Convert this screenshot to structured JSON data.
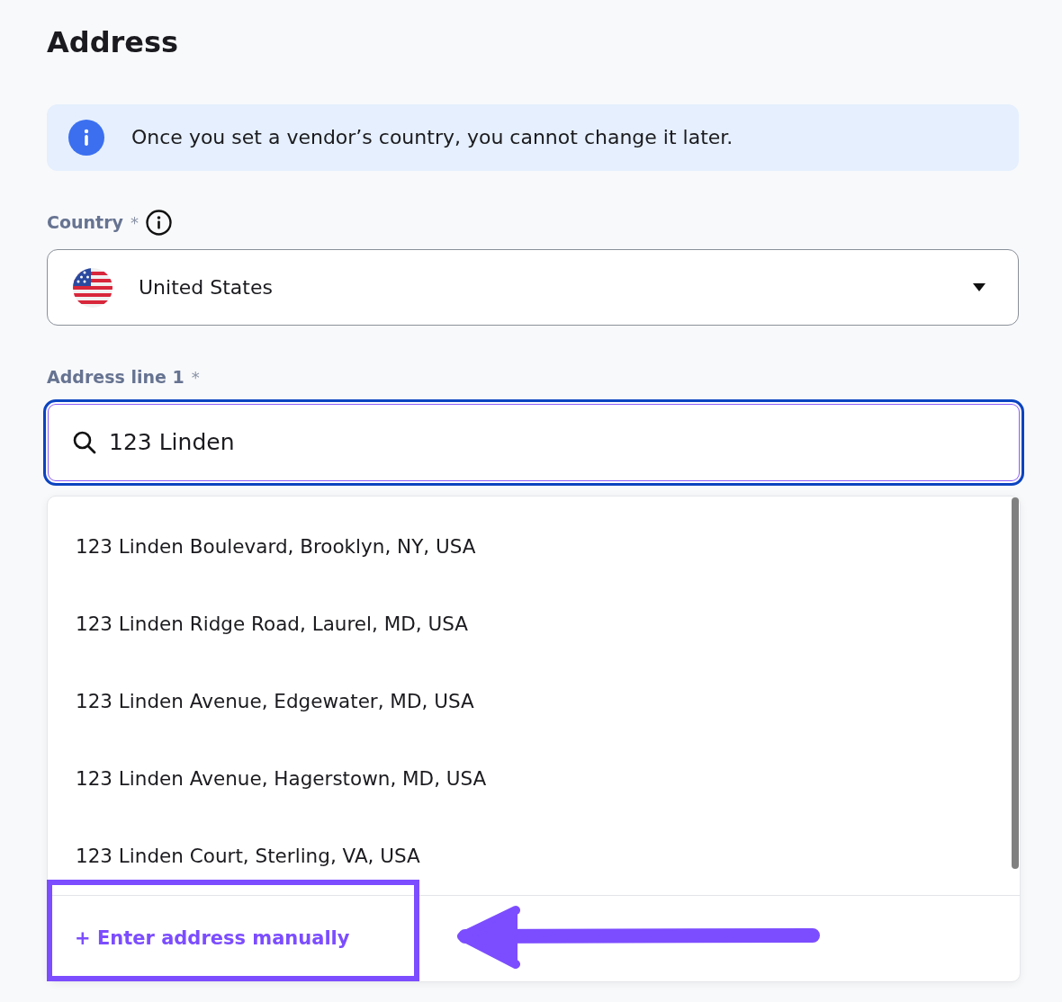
{
  "page_title": "Address",
  "notice": {
    "text": "Once you set a vendor’s country, you cannot change it later."
  },
  "country": {
    "label": "Country",
    "required_mark": "*",
    "value": "United States"
  },
  "address_line_1": {
    "label": "Address line 1",
    "required_mark": "*",
    "value": "123 Linden",
    "focused": true
  },
  "suggestions": {
    "options": [
      {
        "label": "123 Linden Boulevard, Brooklyn, NY, USA",
        "selected": false
      },
      {
        "label": "123 Linden Ridge Road, Laurel, MD, USA",
        "selected": false
      },
      {
        "label": "123 Linden Avenue, Edgewater, MD, USA",
        "selected": false
      },
      {
        "label": "123 Linden Avenue, Hagerstown, MD, USA",
        "selected": false
      },
      {
        "label": "123 Linden Court, Sterling, VA, USA",
        "selected": false
      }
    ],
    "manual_entry": {
      "label": "+ Enter address manually",
      "highlighted": true
    }
  }
}
